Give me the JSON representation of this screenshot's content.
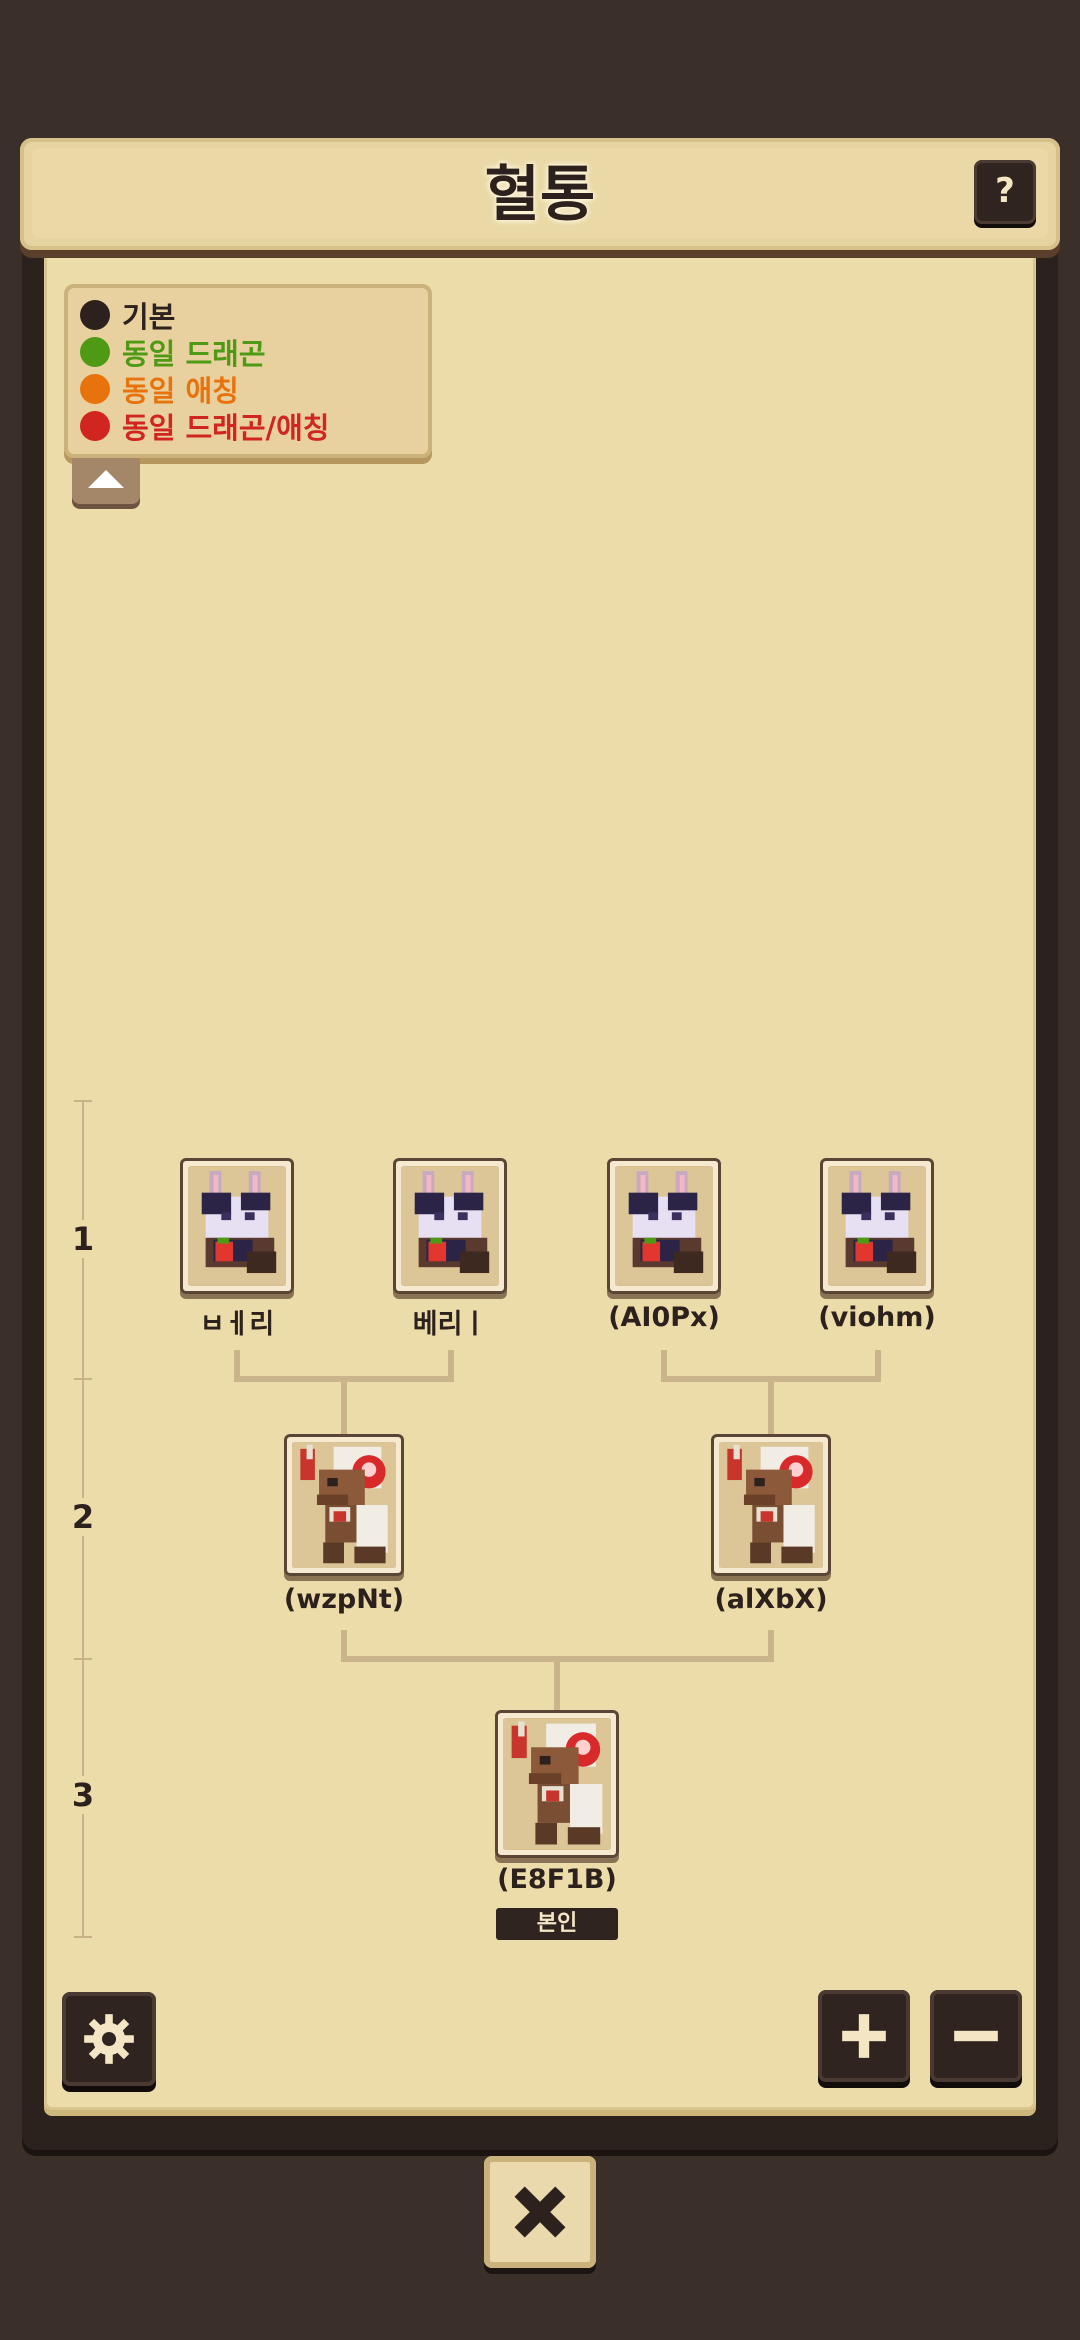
{
  "header": {
    "title": "혈통",
    "help_label": "?"
  },
  "legend": {
    "items": [
      {
        "label": "기본",
        "color": "#2c211c"
      },
      {
        "label": "동일 드래곤",
        "color": "#4e9a14"
      },
      {
        "label": "동일 애칭",
        "color": "#e8720c"
      },
      {
        "label": "동일 드래곤/애칭",
        "color": "#d0261f"
      }
    ]
  },
  "generations": [
    "1",
    "2",
    "3"
  ],
  "tree": {
    "gen1": [
      {
        "name": "ㅂㅔ리",
        "species": "bunny-berry"
      },
      {
        "name": "베리ㅣ",
        "species": "bunny-berry"
      },
      {
        "name": "(AI0Px)",
        "species": "bunny-berry"
      },
      {
        "name": "(viohm)",
        "species": "bunny-berry"
      }
    ],
    "gen2": [
      {
        "name": "(wzpNt)",
        "species": "red-crest"
      },
      {
        "name": "(alXbX)",
        "species": "red-crest"
      }
    ],
    "gen3": [
      {
        "name": "(E8F1B)",
        "species": "red-crest",
        "badge": "본인"
      }
    ]
  },
  "controls": {
    "settings_icon": "gear-icon",
    "zoom_in_icon": "plus-icon",
    "zoom_out_icon": "minus-icon",
    "close_icon": "close-icon"
  }
}
